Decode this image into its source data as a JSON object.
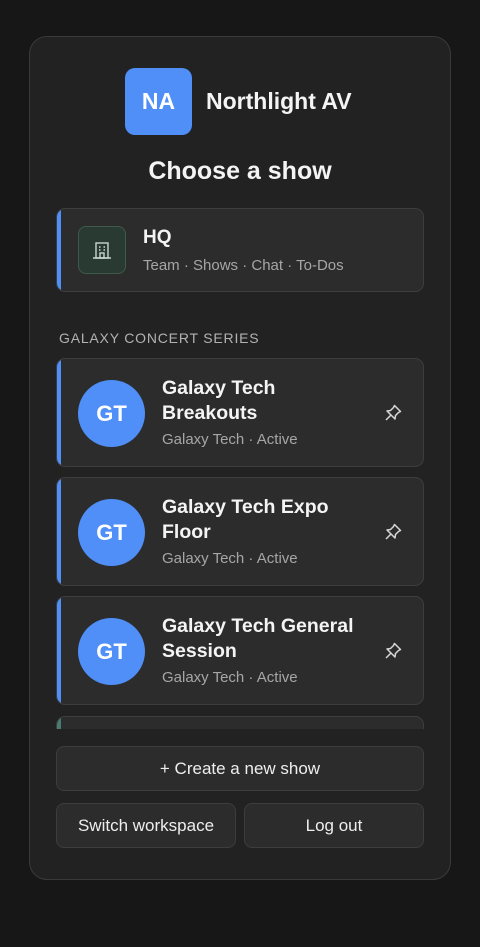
{
  "brand": {
    "initials": "NA",
    "name": "Northlight AV",
    "accent": "#4f8ff7"
  },
  "page_title": "Choose a show",
  "hq": {
    "title": "HQ",
    "subtitle": "Team · Shows · Chat · To-Dos",
    "icon": "building-icon"
  },
  "section_label": "GALAXY CONCERT SERIES",
  "shows": [
    {
      "initials": "GT",
      "title": "Galaxy Tech Breakouts",
      "meta": "Galaxy Tech · Active",
      "icon": "pin-icon"
    },
    {
      "initials": "GT",
      "title": "Galaxy Tech Expo Floor",
      "meta": "Galaxy Tech · Active",
      "icon": "pin-icon"
    },
    {
      "initials": "GT",
      "title": "Galaxy Tech General Session",
      "meta": "Galaxy Tech · Active",
      "icon": "pin-icon"
    }
  ],
  "actions": {
    "create_label": "+ Create a new show",
    "switch_label": "Switch workspace",
    "logout_label": "Log out"
  }
}
